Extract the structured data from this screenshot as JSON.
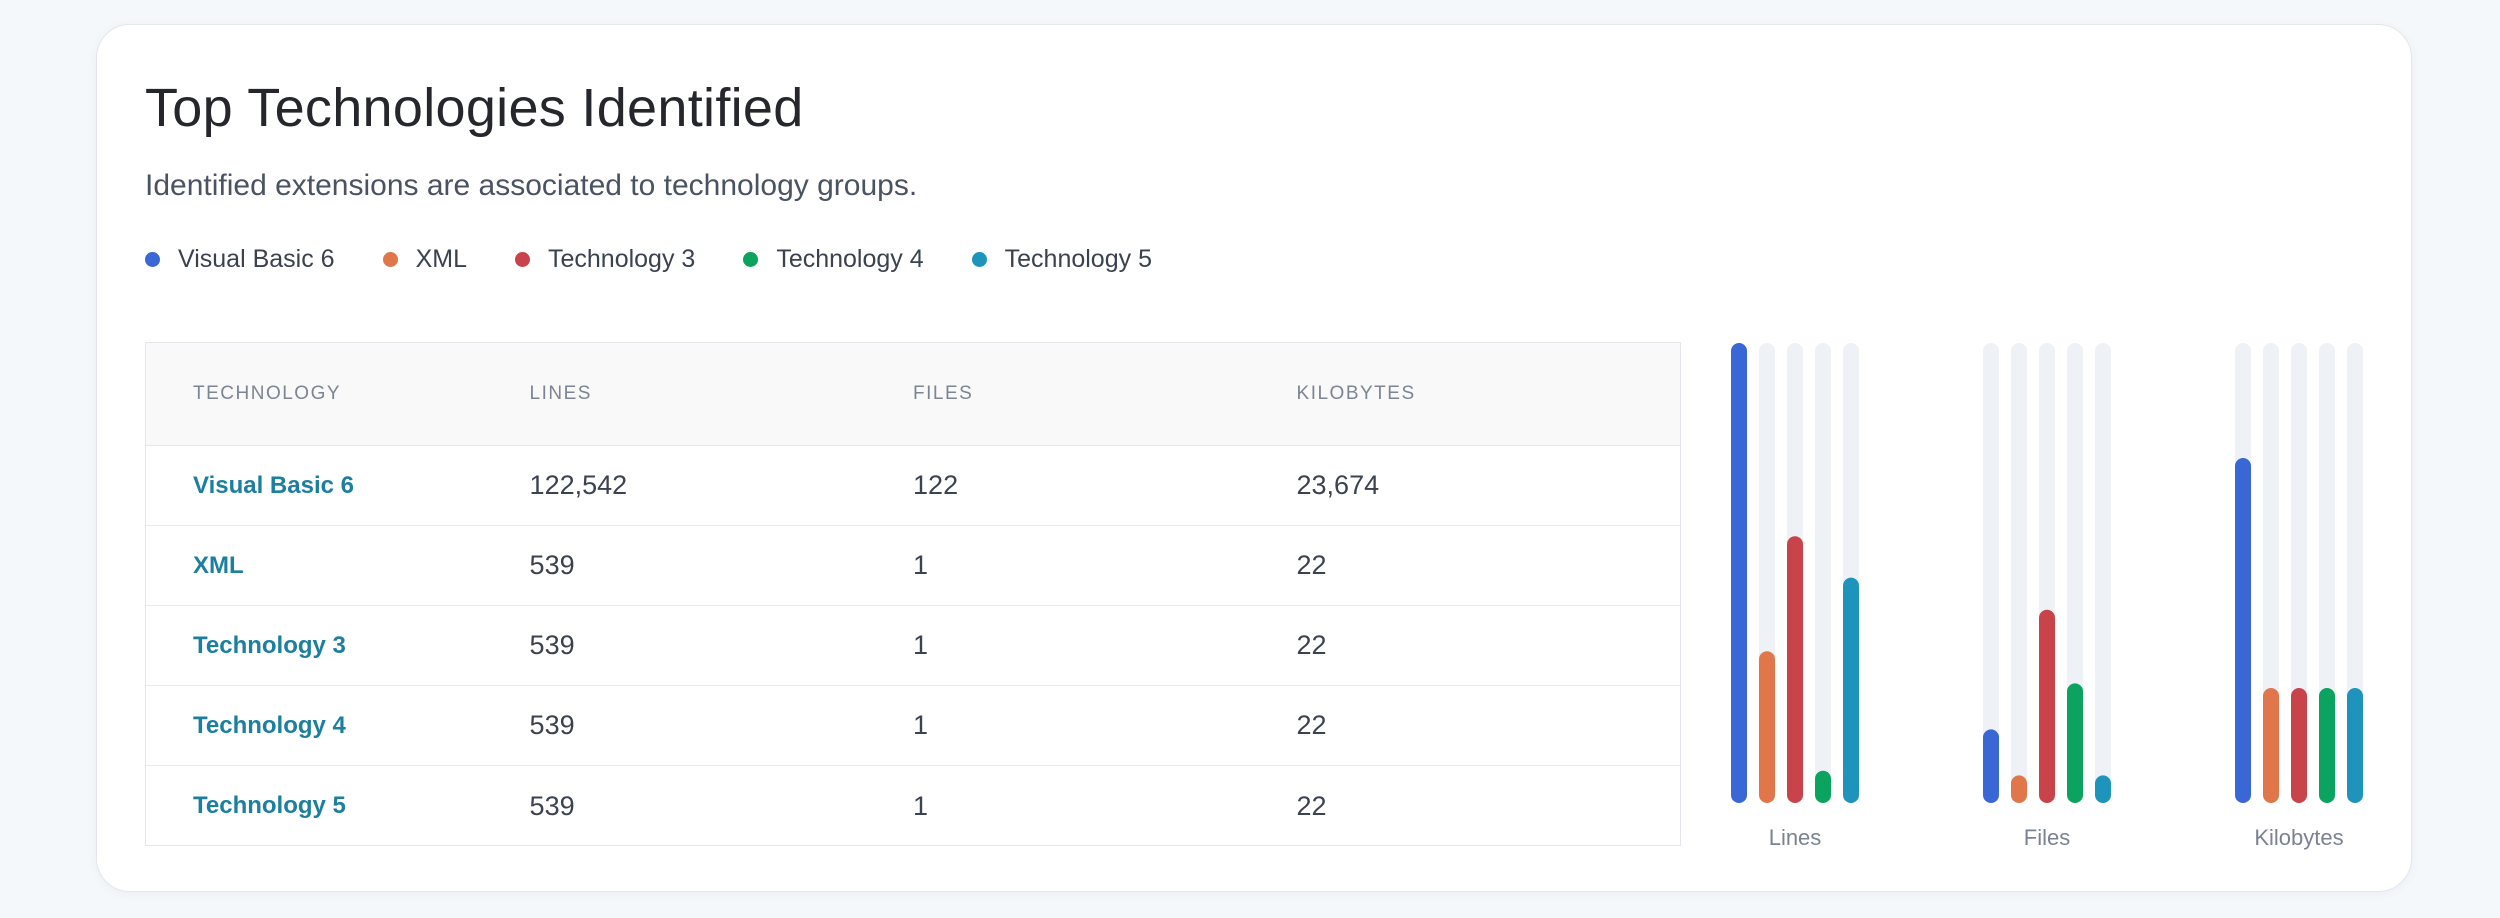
{
  "title": "Top Technologies Identified",
  "subtitle": "Identified extensions are associated to technology groups.",
  "legend": [
    {
      "label": "Visual Basic 6",
      "color": "#3a67d6"
    },
    {
      "label": "XML",
      "color": "#e0764a"
    },
    {
      "label": "Technology 3",
      "color": "#c9444a"
    },
    {
      "label": "Technology 4",
      "color": "#0aa35f"
    },
    {
      "label": "Technology 5",
      "color": "#1e94bd"
    }
  ],
  "table": {
    "headers": [
      "Technology",
      "Lines",
      "Files",
      "Kilobytes"
    ],
    "rows": [
      {
        "technology": "Visual Basic 6",
        "lines": "122,542",
        "files": "122",
        "kilobytes": "23,674"
      },
      {
        "technology": "XML",
        "lines": "539",
        "files": "1",
        "kilobytes": "22"
      },
      {
        "technology": "Technology 3",
        "lines": "539",
        "files": "1",
        "kilobytes": "22"
      },
      {
        "technology": "Technology 4",
        "lines": "539",
        "files": "1",
        "kilobytes": "22"
      },
      {
        "technology": "Technology 5",
        "lines": "539",
        "files": "1",
        "kilobytes": "22"
      }
    ]
  },
  "chart_data": [
    {
      "type": "bar",
      "title": "Lines",
      "categories": [
        "Visual Basic 6",
        "XML",
        "Technology 3",
        "Technology 4",
        "Technology 5"
      ],
      "values": [
        1.0,
        0.33,
        0.58,
        0.07,
        0.49
      ]
    },
    {
      "type": "bar",
      "title": "Files",
      "categories": [
        "Visual Basic 6",
        "XML",
        "Technology 3",
        "Technology 4",
        "Technology 5"
      ],
      "values": [
        0.16,
        0.06,
        0.42,
        0.26,
        0.06
      ]
    },
    {
      "type": "bar",
      "title": "Kilobytes",
      "categories": [
        "Visual Basic 6",
        "XML",
        "Technology 3",
        "Technology 4",
        "Technology 5"
      ],
      "values": [
        0.75,
        0.25,
        0.25,
        0.25,
        0.25
      ]
    }
  ],
  "colors": {
    "track": "#eef1f5",
    "link": "#1d7fa0"
  }
}
